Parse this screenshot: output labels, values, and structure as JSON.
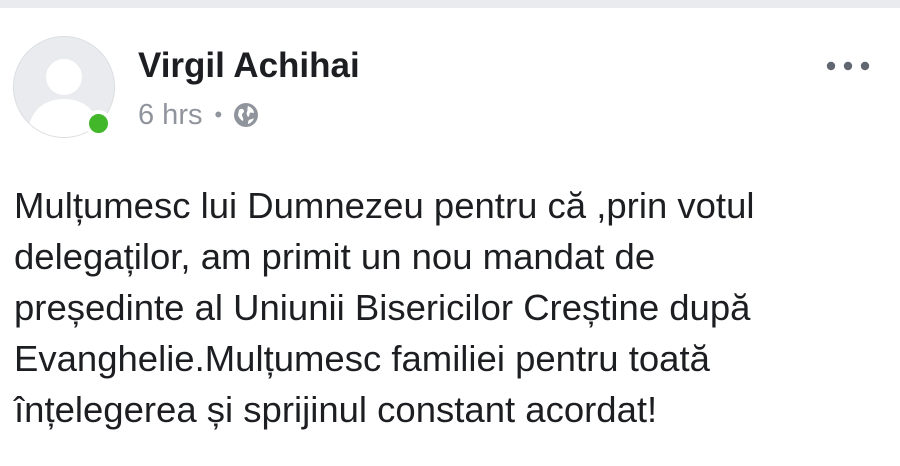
{
  "post": {
    "author": "Virgil Achihai",
    "time": "6 hrs",
    "separator": "•",
    "privacy_icon": "globe-icon",
    "online": true,
    "more_icon": "more-options-icon",
    "text": "Mulțumesc lui Dumnezeu pentru că ,prin votul\ndelegaților, am primit un nou mandat de\npreședinte al Uniunii Bisericilor Creștine după\nEvanghelie.Mulțumesc familiei pentru toată\nînțelegerea și sprijinul constant acordat!"
  },
  "colors": {
    "background": "#ffffff",
    "top_strip": "#e9ebee",
    "name": "#1c1e21",
    "meta": "#90949c",
    "online_dot": "#42b72a",
    "avatar_bg": "#e9ebee"
  }
}
